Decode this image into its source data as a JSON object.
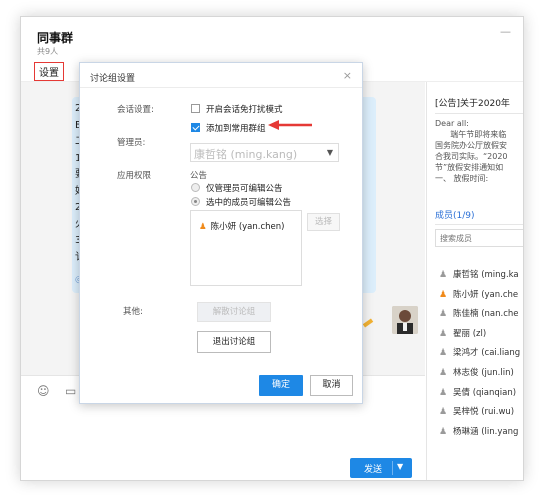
{
  "header": {
    "group_name": "同事群",
    "member_count": "共9人",
    "settings_link": "设置",
    "minimize_symbol": "—"
  },
  "chat": {
    "bubble_left_chars": [
      "2",
      "E",
      "二",
      "1",
      "要",
      "好",
      "2",
      "火",
      "3",
      "讠"
    ],
    "bubble_right_chars": [
      "器",
      "管",
      "",
      "防",
      "",
      "申"
    ],
    "tools": {
      "emoji_icon": "smile-icon",
      "image_icon": "image-icon"
    },
    "send_label": "发送"
  },
  "right_panel": {
    "notice_title": "[公告]关于2020年",
    "notice_body": "Dear all:\n      端午节即将来临\n国务院办公厅放假安\n合我司实际。“2020\n节”放假安排通知如\n一、 放假时间:",
    "members_title": "成员(1/9)",
    "search_placeholder": "搜索成员",
    "members": [
      {
        "name": "康哲铭 (ming.ka",
        "highlight": false
      },
      {
        "name": "陈小妍 (yan.che",
        "highlight": true
      },
      {
        "name": "陈佳楠 (nan.che",
        "highlight": false
      },
      {
        "name": "翟丽 (zl)",
        "highlight": false
      },
      {
        "name": "梁鸿才 (cai.liang",
        "highlight": false
      },
      {
        "name": "林志俊 (jun.lin)",
        "highlight": false
      },
      {
        "name": "吴倩 (qianqian)",
        "highlight": false
      },
      {
        "name": "吴梓悦 (rui.wu)",
        "highlight": false
      },
      {
        "name": "杨琳涵 (lin.yang",
        "highlight": false
      }
    ],
    "member_icon_color": "#9a9a9a",
    "member_highlight_color": "#f08a1a"
  },
  "modal": {
    "title": "讨论组设置",
    "close_symbol": "×",
    "session_label": "会话设置:",
    "dnd_option": "开启会话免打扰模式",
    "dnd_checked": false,
    "common_group_option": "添加到常用群组",
    "common_group_checked": true,
    "admin_label": "管理员:",
    "admin_value": "康哲铭 (ming.kang)",
    "perm_label": "应用权限",
    "notice_label": "公告",
    "radio_admin_only": "仅管理员可编辑公告",
    "radio_selected": "选中的成员可编辑公告",
    "selected_member": "陈小妍 (yan.chen)",
    "select_button": "选择",
    "other_label": "其他:",
    "disband_button": "解散讨论组",
    "quit_button": "退出讨论组",
    "ok_button": "确定",
    "cancel_button": "取消",
    "accent_color": "#1e88e5",
    "arrow_color": "#e53935"
  }
}
